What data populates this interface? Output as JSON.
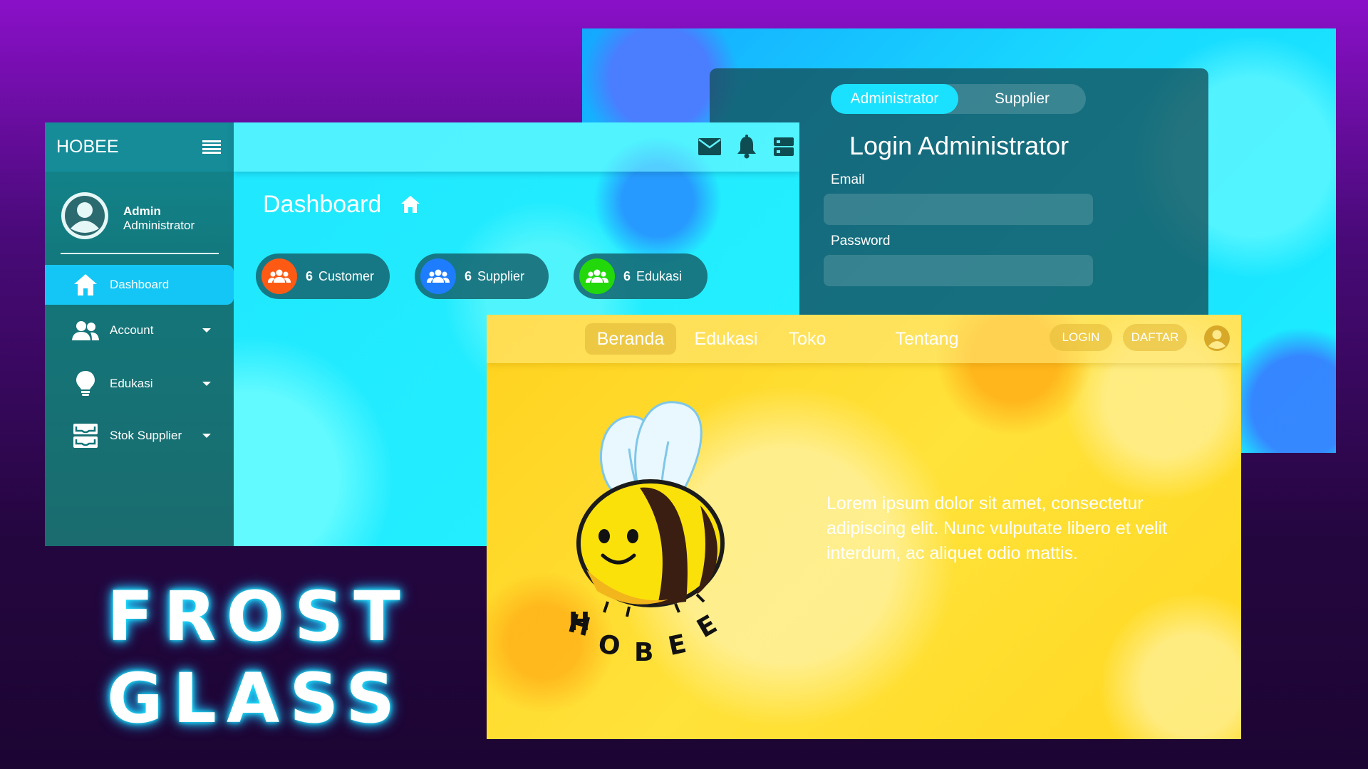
{
  "login": {
    "tabs": [
      "Administrator",
      "Supplier"
    ],
    "title": "Login Administrator",
    "email_label": "Email",
    "password_label": "Password",
    "email_value": "",
    "password_value": ""
  },
  "dashboard": {
    "brand": "HOBEE",
    "profile": {
      "name": "Admin",
      "role": "Administrator"
    },
    "nav": [
      {
        "label": "Dashboard",
        "icon": "home-icon"
      },
      {
        "label": "Account",
        "icon": "users-icon"
      },
      {
        "label": "Edukasi",
        "icon": "lightbulb-icon"
      },
      {
        "label": "Stok Supplier",
        "icon": "inbox-icon"
      }
    ],
    "title": "Dashboard",
    "stats": [
      {
        "count": "6",
        "label": "Customer",
        "color": "#ff5a14"
      },
      {
        "count": "6",
        "label": "Supplier",
        "color": "#1e7cff"
      },
      {
        "count": "6",
        "label": "Edukasi",
        "color": "#22d80a"
      }
    ],
    "colors": {
      "accent": "#14c6f5",
      "sidebar": "#137579",
      "topbar_icon": "#0e4d52"
    }
  },
  "hobee": {
    "nav": [
      "Beranda",
      "Edukasi",
      "Toko",
      "Tentang"
    ],
    "login_button": "LOGIN",
    "register_button": "DAFTAR",
    "description": "Lorem ipsum dolor sit amet, consectetur adipiscing elit. Nunc vulputate libero et velit interdum, ac aliquet odio mattis.",
    "logo_text": "HOBEE"
  },
  "headline": {
    "line1": "FROST",
    "line2": "GLASS"
  }
}
